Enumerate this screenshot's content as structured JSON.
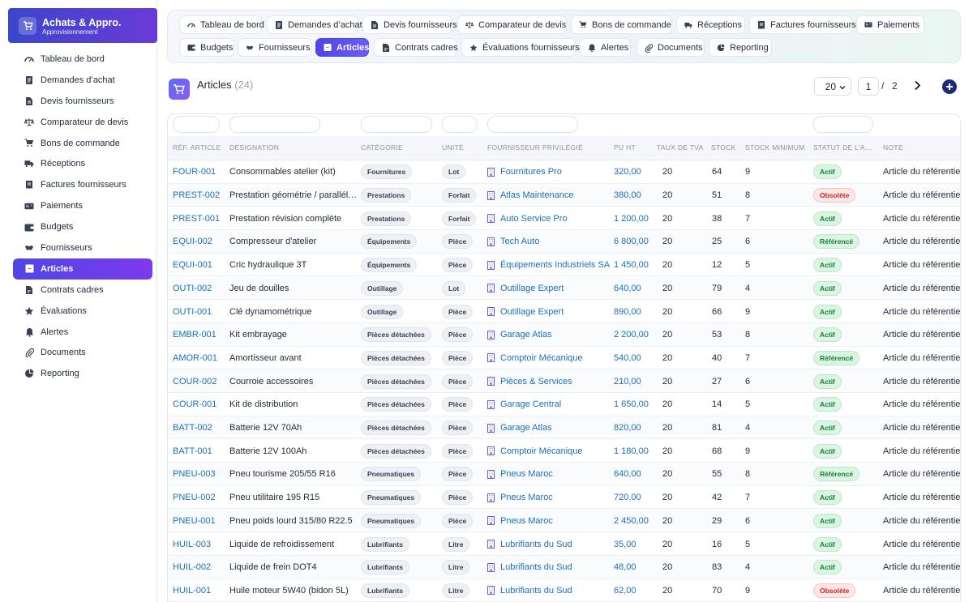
{
  "brand": {
    "title": "Achats & Appro.",
    "subtitle": "Approvisionnement"
  },
  "sidebar": {
    "items": [
      {
        "label": "Tableau de bord",
        "icon": "gauge-icon",
        "active": false
      },
      {
        "label": "Demandes d’achat",
        "icon": "document-icon",
        "active": false
      },
      {
        "label": "Devis fournisseurs",
        "icon": "file-icon",
        "active": false
      },
      {
        "label": "Comparateur de devis",
        "icon": "scale-icon",
        "active": false
      },
      {
        "label": "Bons de commande",
        "icon": "cart-icon",
        "active": false
      },
      {
        "label": "Réceptions",
        "icon": "truck-icon",
        "active": false
      },
      {
        "label": "Factures fournisseurs",
        "icon": "invoice-icon",
        "active": false
      },
      {
        "label": "Paiements",
        "icon": "money-icon",
        "active": false
      },
      {
        "label": "Budgets",
        "icon": "wallet-icon",
        "active": false
      },
      {
        "label": "Fournisseurs",
        "icon": "handshake-icon",
        "active": false
      },
      {
        "label": "Articles",
        "icon": "box-icon",
        "active": true
      },
      {
        "label": "Contrats cadres",
        "icon": "contract-icon",
        "active": false
      },
      {
        "label": "Évaluations",
        "icon": "star-icon",
        "active": false
      },
      {
        "label": "Alertes",
        "icon": "bell-icon",
        "active": false
      },
      {
        "label": "Documents",
        "icon": "paperclip-icon",
        "active": false
      },
      {
        "label": "Reporting",
        "icon": "pie-chart-icon",
        "active": false
      }
    ]
  },
  "tabs": [
    {
      "label": "Tableau de bord",
      "icon": "gauge-icon",
      "active": false
    },
    {
      "label": "Demandes d’achat",
      "icon": "document-icon",
      "active": false
    },
    {
      "label": "Devis fournisseurs",
      "icon": "file-icon",
      "active": false
    },
    {
      "label": "Comparateur de devis",
      "icon": "scale-icon",
      "active": false
    },
    {
      "label": "Bons de commande",
      "icon": "cart-icon",
      "active": false
    },
    {
      "label": "Réceptions",
      "icon": "truck-icon",
      "active": false
    },
    {
      "label": "Factures fournisseurs",
      "icon": "invoice-icon",
      "active": false
    },
    {
      "label": "Paiements",
      "icon": "money-icon",
      "active": false
    },
    {
      "label": "Budgets",
      "icon": "wallet-icon",
      "active": false
    },
    {
      "label": "Fournisseurs",
      "icon": "handshake-icon",
      "active": false
    },
    {
      "label": "Articles",
      "icon": "box-icon",
      "active": true
    },
    {
      "label": "Contrats cadres",
      "icon": "contract-icon",
      "active": false
    },
    {
      "label": "Évaluations fournisseurs",
      "icon": "star-icon",
      "active": false
    },
    {
      "label": "Alertes",
      "icon": "bell-icon",
      "active": false
    },
    {
      "label": "Documents",
      "icon": "paperclip-icon",
      "active": false
    },
    {
      "label": "Reporting",
      "icon": "pie-chart-icon",
      "active": false
    }
  ],
  "header": {
    "title": "Articles",
    "count": "(24)",
    "page_size": "20",
    "page_current": "1",
    "page_separator": "/",
    "page_total": "2"
  },
  "colors": {
    "accent": "#4f46e5",
    "link": "#1a6fc1",
    "active_status": "#15803d",
    "obsolete_status": "#c62828",
    "add_button": "#1e2a78"
  },
  "table": {
    "columns": [
      "RÉF. ARTICLE",
      "DÉSIGNATION",
      "CATÉGORIE",
      "UNITÉ",
      "FOURNISSEUR PRIVILÉGIÉ",
      "PU HT",
      "TAUX DE TVA",
      "STOCK",
      "STOCK MINIMUM",
      "STATUT DE L’A…",
      "NOTE"
    ],
    "rows": [
      {
        "ref": "FOUR-001",
        "designation": "Consommables atelier (kit)",
        "category": "Fournitures",
        "unit": "Lot",
        "supplier": "Fournitures Pro",
        "price": "320,00",
        "vat": "20",
        "stock": "64",
        "min": "9",
        "status": "Actif",
        "note": "Article du référentiel"
      },
      {
        "ref": "PREST-002",
        "designation": "Prestation géométrie / parallél…",
        "category": "Prestations",
        "unit": "Forfait",
        "supplier": "Atlas Maintenance",
        "price": "380,00",
        "vat": "20",
        "stock": "51",
        "min": "8",
        "status": "Obsolète",
        "note": "Article du référentiel"
      },
      {
        "ref": "PREST-001",
        "designation": "Prestation révision complète",
        "category": "Prestations",
        "unit": "Forfait",
        "supplier": "Auto Service Pro",
        "price": "1 200,00",
        "vat": "20",
        "stock": "38",
        "min": "7",
        "status": "Actif",
        "note": "Article du référentiel"
      },
      {
        "ref": "EQUI-002",
        "designation": "Compresseur d'atelier",
        "category": "Équipements",
        "unit": "Pièce",
        "supplier": "Tech Auto",
        "price": "6 800,00",
        "vat": "20",
        "stock": "25",
        "min": "6",
        "status": "Référencé",
        "note": "Article du référentiel"
      },
      {
        "ref": "EQUI-001",
        "designation": "Cric hydraulique 3T",
        "category": "Équipements",
        "unit": "Pièce",
        "supplier": "Équipements Industriels SA",
        "price": "1 450,00",
        "vat": "20",
        "stock": "12",
        "min": "5",
        "status": "Actif",
        "note": "Article du référentiel"
      },
      {
        "ref": "OUTI-002",
        "designation": "Jeu de douilles",
        "category": "Outillage",
        "unit": "Lot",
        "supplier": "Outillage Expert",
        "price": "640,00",
        "vat": "20",
        "stock": "79",
        "min": "4",
        "status": "Actif",
        "note": "Article du référentiel"
      },
      {
        "ref": "OUTI-001",
        "designation": "Clé dynamométrique",
        "category": "Outillage",
        "unit": "Pièce",
        "supplier": "Outillage Expert",
        "price": "890,00",
        "vat": "20",
        "stock": "66",
        "min": "9",
        "status": "Actif",
        "note": "Article du référentiel"
      },
      {
        "ref": "EMBR-001",
        "designation": "Kit embrayage",
        "category": "Pièces détachées",
        "unit": "Pièce",
        "supplier": "Garage Atlas",
        "price": "2 200,00",
        "vat": "20",
        "stock": "53",
        "min": "8",
        "status": "Actif",
        "note": "Article du référentiel"
      },
      {
        "ref": "AMOR-001",
        "designation": "Amortisseur avant",
        "category": "Pièces détachées",
        "unit": "Pièce",
        "supplier": "Comptoir Mécanique",
        "price": "540,00",
        "vat": "20",
        "stock": "40",
        "min": "7",
        "status": "Référencé",
        "note": "Article du référentiel"
      },
      {
        "ref": "COUR-002",
        "designation": "Courroie accessoires",
        "category": "Pièces détachées",
        "unit": "Pièce",
        "supplier": "Pièces & Services",
        "price": "210,00",
        "vat": "20",
        "stock": "27",
        "min": "6",
        "status": "Actif",
        "note": "Article du référentiel"
      },
      {
        "ref": "COUR-001",
        "designation": "Kit de distribution",
        "category": "Pièces détachées",
        "unit": "Pièce",
        "supplier": "Garage Central",
        "price": "1 650,00",
        "vat": "20",
        "stock": "14",
        "min": "5",
        "status": "Actif",
        "note": "Article du référentiel"
      },
      {
        "ref": "BATT-002",
        "designation": "Batterie 12V 70Ah",
        "category": "Pièces détachées",
        "unit": "Pièce",
        "supplier": "Garage Atlas",
        "price": "820,00",
        "vat": "20",
        "stock": "81",
        "min": "4",
        "status": "Actif",
        "note": "Article du référentiel"
      },
      {
        "ref": "BATT-001",
        "designation": "Batterie 12V 100Ah",
        "category": "Pièces détachées",
        "unit": "Pièce",
        "supplier": "Comptoir Mécanique",
        "price": "1 180,00",
        "vat": "20",
        "stock": "68",
        "min": "9",
        "status": "Actif",
        "note": "Article du référentiel"
      },
      {
        "ref": "PNEU-003",
        "designation": "Pneu tourisme 205/55 R16",
        "category": "Pneumatiques",
        "unit": "Pièce",
        "supplier": "Pneus Maroc",
        "price": "640,00",
        "vat": "20",
        "stock": "55",
        "min": "8",
        "status": "Référencé",
        "note": "Article du référentiel"
      },
      {
        "ref": "PNEU-002",
        "designation": "Pneu utilitaire 195 R15",
        "category": "Pneumatiques",
        "unit": "Pièce",
        "supplier": "Pneus Maroc",
        "price": "720,00",
        "vat": "20",
        "stock": "42",
        "min": "7",
        "status": "Actif",
        "note": "Article du référentiel"
      },
      {
        "ref": "PNEU-001",
        "designation": "Pneu poids lourd 315/80 R22.5",
        "category": "Pneumatiques",
        "unit": "Pièce",
        "supplier": "Pneus Maroc",
        "price": "2 450,00",
        "vat": "20",
        "stock": "29",
        "min": "6",
        "status": "Actif",
        "note": "Article du référentiel"
      },
      {
        "ref": "HUIL-003",
        "designation": "Liquide de refroidissement",
        "category": "Lubrifiants",
        "unit": "Litre",
        "supplier": "Lubrifiants du Sud",
        "price": "35,00",
        "vat": "20",
        "stock": "16",
        "min": "5",
        "status": "Actif",
        "note": "Article du référentiel"
      },
      {
        "ref": "HUIL-002",
        "designation": "Liquide de frein DOT4",
        "category": "Lubrifiants",
        "unit": "Litre",
        "supplier": "Lubrifiants du Sud",
        "price": "48,00",
        "vat": "20",
        "stock": "83",
        "min": "4",
        "status": "Actif",
        "note": "Article du référentiel"
      },
      {
        "ref": "HUIL-001",
        "designation": "Huile moteur 5W40 (bidon 5L)",
        "category": "Lubrifiants",
        "unit": "Litre",
        "supplier": "Lubrifiants du Sud",
        "price": "62,00",
        "vat": "20",
        "stock": "70",
        "min": "9",
        "status": "Obsolète",
        "note": "Article du référentiel"
      }
    ]
  }
}
